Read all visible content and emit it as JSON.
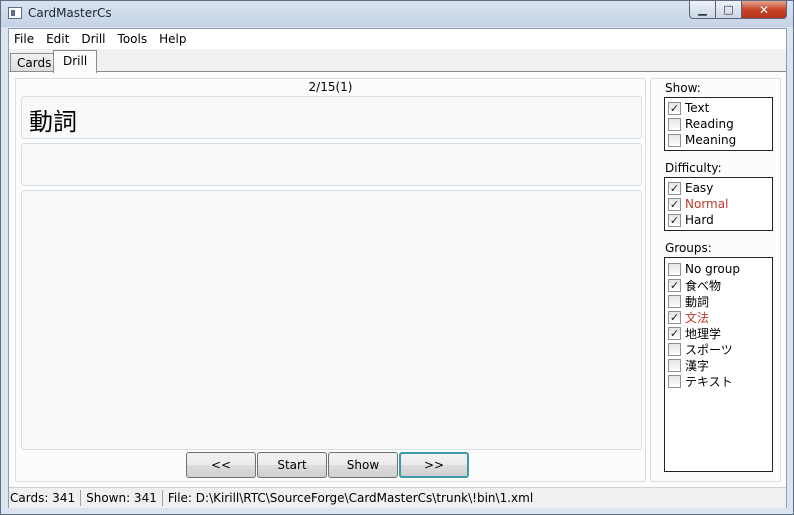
{
  "window": {
    "title": "CardMasterCs",
    "minimize_glyph": "▁",
    "maximize_glyph": "□",
    "close_glyph": "✕"
  },
  "menu": {
    "items": [
      "File",
      "Edit",
      "Drill",
      "Tools",
      "Help"
    ]
  },
  "tabs": {
    "items": [
      "Cards",
      "Drill"
    ],
    "active": "Drill"
  },
  "drill": {
    "counter": "2/15(1)",
    "text": "動詞",
    "reading": "",
    "meaning": "",
    "buttons": {
      "prev": "<<",
      "start": "Start",
      "show": "Show",
      "next": ">>"
    }
  },
  "show": {
    "label": "Show:",
    "options": [
      {
        "label": "Text",
        "checked": true
      },
      {
        "label": "Reading",
        "checked": false
      },
      {
        "label": "Meaning",
        "checked": false
      }
    ]
  },
  "difficulty": {
    "label": "Difficulty:",
    "options": [
      {
        "label": "Easy",
        "checked": true
      },
      {
        "label": "Normal",
        "checked": true,
        "color": "#c0392b"
      },
      {
        "label": "Hard",
        "checked": true
      }
    ]
  },
  "groups": {
    "label": "Groups:",
    "options": [
      {
        "label": "No group",
        "checked": false
      },
      {
        "label": "食べ物",
        "checked": true
      },
      {
        "label": "動詞",
        "checked": false
      },
      {
        "label": "文法",
        "checked": true,
        "color": "#c0392b"
      },
      {
        "label": "地理学",
        "checked": true
      },
      {
        "label": "スポーツ",
        "checked": false
      },
      {
        "label": "漢字",
        "checked": false
      },
      {
        "label": "テキスト",
        "checked": false
      }
    ]
  },
  "status": {
    "cards": "Cards: 341",
    "shown": "Shown: 341",
    "file": "File: D:\\Kirill\\RTC\\SourceForge\\CardMasterCs\\trunk\\!bin\\1.xml"
  },
  "check_glyph": "✓"
}
